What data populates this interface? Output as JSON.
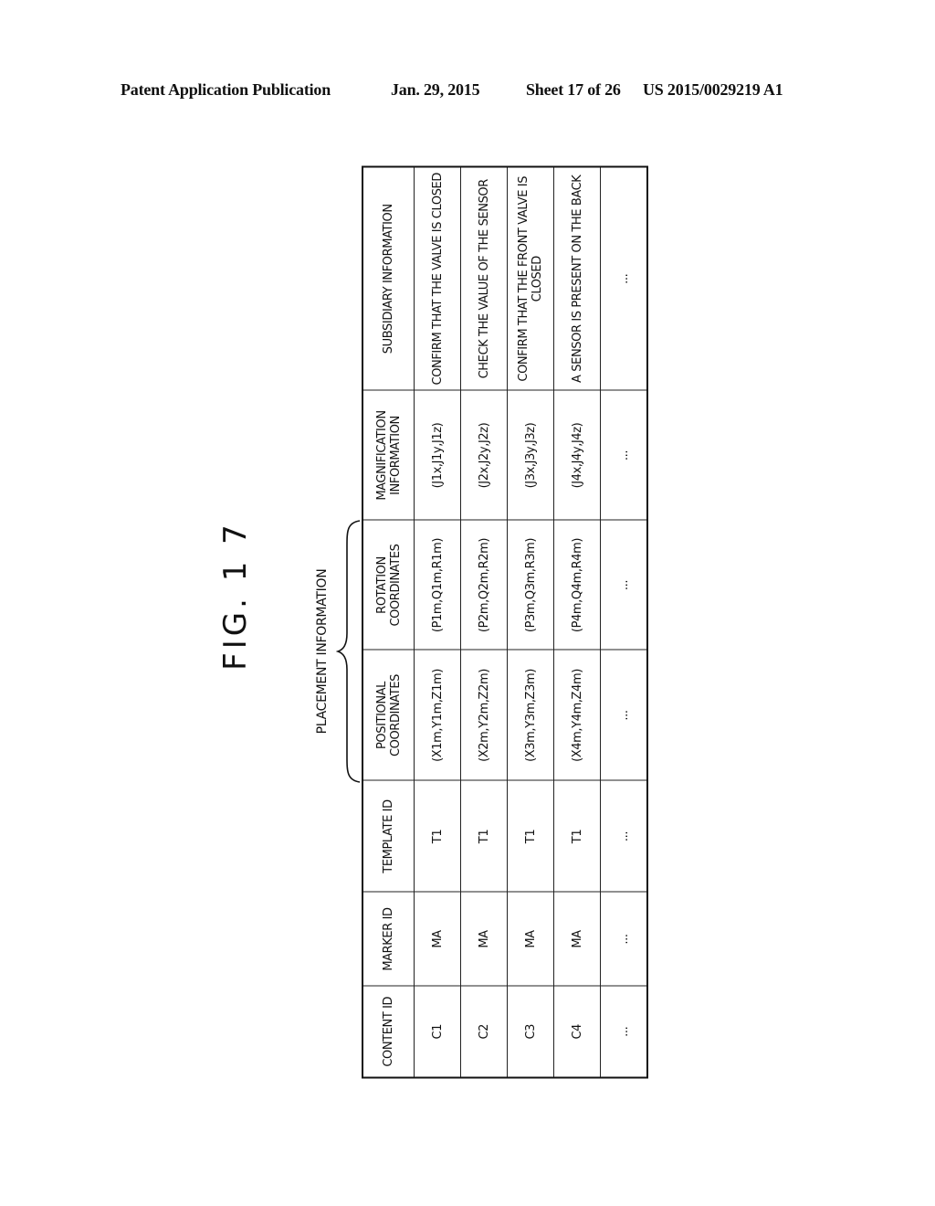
{
  "page_header": {
    "publication": "Patent Application Publication",
    "date": "Jan. 29, 2015",
    "sheet": "Sheet 17 of 26",
    "number": "US 2015/0029219 A1"
  },
  "figure": {
    "title": "FIG. 1 7",
    "group_label": "PLACEMENT INFORMATION"
  },
  "table": {
    "headers": [
      "CONTENT ID",
      "MARKER ID",
      "TEMPLATE ID",
      "POSITIONAL COORDINATES",
      "ROTATION COORDINATES",
      "MAGNIFICATION INFORMATION",
      "SUBSIDIARY INFORMATION"
    ],
    "rows": [
      [
        "C1",
        "MA",
        "T1",
        "(X1m,Y1m,Z1m)",
        "(P1m,Q1m,R1m)",
        "(J1x,J1y,J1z)",
        "CONFIRM THAT THE VALVE IS CLOSED"
      ],
      [
        "C2",
        "MA",
        "T1",
        "(X2m,Y2m,Z2m)",
        "(P2m,Q2m,R2m)",
        "(J2x,J2y,J2z)",
        "CHECK THE VALUE OF THE SENSOR"
      ],
      [
        "C3",
        "MA",
        "T1",
        "(X3m,Y3m,Z3m)",
        "(P3m,Q3m,R3m)",
        "(J3x,J3y,J3z)",
        "CONFIRM THAT THE FRONT VALVE IS CLOSED"
      ],
      [
        "C4",
        "MA",
        "T1",
        "(X4m,Y4m,Z4m)",
        "(P4m,Q4m,R4m)",
        "(J4x,J4y,J4z)",
        "A SENSOR IS PRESENT ON THE BACK"
      ],
      [
        "...",
        "...",
        "...",
        "...",
        "...",
        "...",
        "..."
      ]
    ]
  }
}
